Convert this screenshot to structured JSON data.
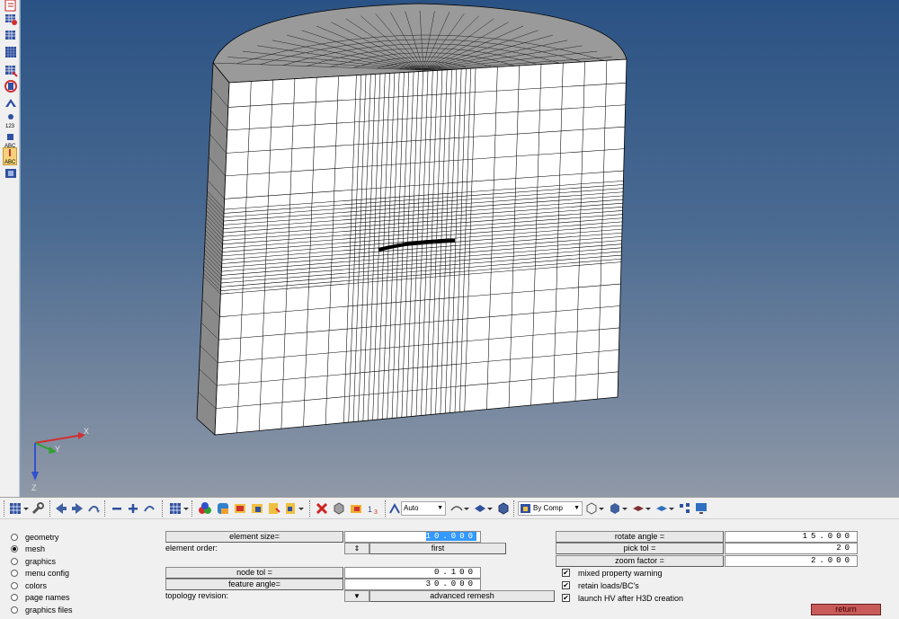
{
  "viewport": {
    "triad_labels": {
      "x": "X",
      "y": "Y",
      "z": "Z"
    }
  },
  "left_toolbar": {
    "icons": [
      "page-icon",
      "mesh-icon",
      "component-icon",
      "solid-icon",
      "mask-icon",
      "no-icon",
      "transform-icon",
      "node-ids-icon",
      "element-ids-icon",
      "labels-active-icon",
      "frame-icon"
    ]
  },
  "bottom_toolbar": {
    "entity_select": "Auto",
    "color_mode": "By Comp"
  },
  "panel": {
    "radios": [
      {
        "label": "geometry",
        "checked": false
      },
      {
        "label": "mesh",
        "checked": true
      },
      {
        "label": "graphics",
        "checked": false
      },
      {
        "label": "menu config",
        "checked": false
      },
      {
        "label": "colors",
        "checked": false
      },
      {
        "label": "page names",
        "checked": false
      },
      {
        "label": "graphics files",
        "checked": false
      }
    ],
    "element_size_label": "element size=",
    "element_size_value": "10.000",
    "element_order_label": "element order:",
    "element_order_toggle": "⇕",
    "element_order_value": "first",
    "node_tol_label": "node tol =",
    "node_tol_value": "0.100",
    "feature_angle_label": "feature angle=",
    "feature_angle_value": "30.000",
    "topology_revision_label": "topology revision:",
    "topology_revision_toggle": "▼",
    "topology_revision_value": "advanced remesh",
    "rotate_angle_label": "rotate angle =",
    "rotate_angle_value": "15.000",
    "pick_tol_label": "pick tol =",
    "pick_tol_value": "20",
    "zoom_factor_label": "zoom factor =",
    "zoom_factor_value": "2.000",
    "checks": [
      {
        "label": "mixed property warning",
        "checked": true
      },
      {
        "label": "retain loads/BC's",
        "checked": true
      },
      {
        "label": "launch HV after H3D creation",
        "checked": true
      }
    ],
    "return_label": "return",
    "colors": {
      "return_button": "#c85a5a",
      "selection": "#3399ff"
    }
  }
}
